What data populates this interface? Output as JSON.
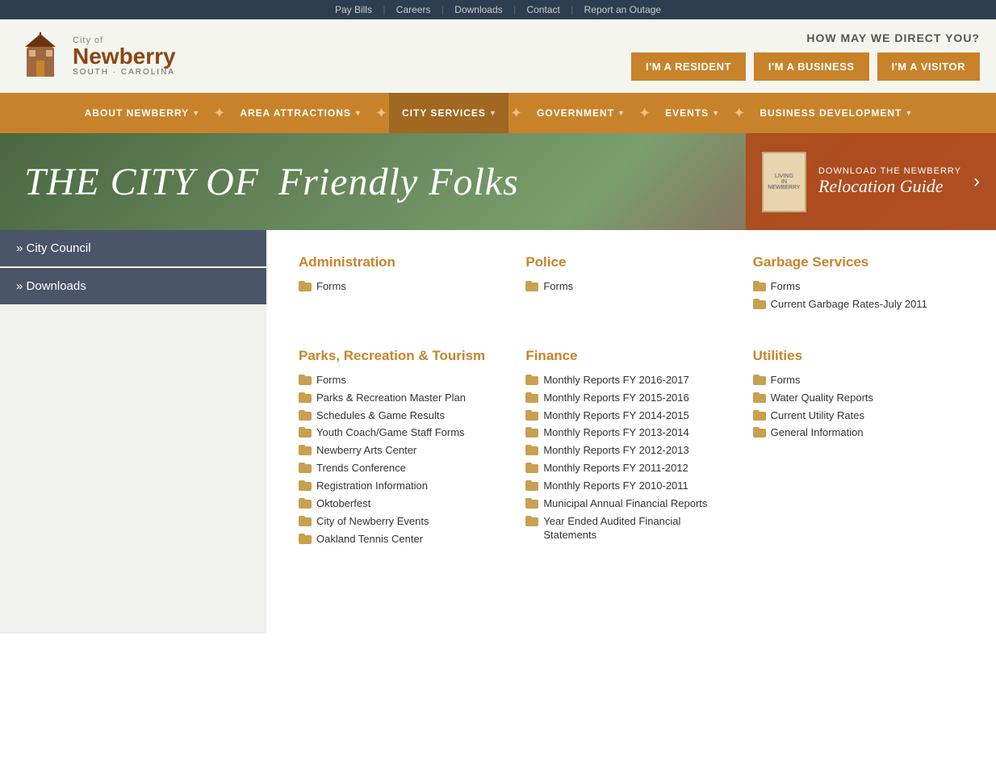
{
  "topbar": {
    "links": [
      "Pay Bills",
      "Careers",
      "Downloads",
      "Contact",
      "Report an Outage"
    ]
  },
  "header": {
    "logo_city": "City of",
    "logo_name": "Newberry",
    "logo_state": "SOUTH · CAROLINA",
    "tagline": "HOW MAY WE DIRECT YOU?",
    "buttons": [
      "I'M A RESIDENT",
      "I'M A BUSINESS",
      "I'M A VISITOR"
    ]
  },
  "nav": {
    "items": [
      "ABOUT NEWBERRY",
      "AREA ATTRACTIONS",
      "CITY SERVICES",
      "GOVERNMENT",
      "EVENTS",
      "BUSINESS DEVELOPMENT"
    ]
  },
  "hero": {
    "text_plain": "THE CITY OF",
    "text_italic": "Friendly Folks",
    "guide_label_small": "DOWNLOAD THE NEWBERRY",
    "guide_label_big": "Relocation Guide"
  },
  "sidebar": {
    "items": [
      {
        "label": "City Council",
        "href": "#"
      },
      {
        "label": "Downloads",
        "href": "#"
      }
    ]
  },
  "page_title": "city SERVICES",
  "sections": {
    "administration": {
      "title": "Administration",
      "items": [
        "Forms"
      ]
    },
    "police": {
      "title": "Police",
      "items": [
        "Forms"
      ]
    },
    "garbage": {
      "title": "Garbage Services",
      "items": [
        "Forms",
        "Current Garbage Rates-July 2011"
      ]
    },
    "parks": {
      "title": "Parks, Recreation & Tourism",
      "items": [
        "Forms",
        "Parks & Recreation Master Plan",
        "Schedules & Game Results",
        "Youth Coach/Game Staff Forms",
        "Newberry Arts Center",
        "Trends Conference",
        "Registration Information",
        "Oktoberfest",
        "City of Newberry Events",
        "Oakland Tennis Center"
      ]
    },
    "finance": {
      "title": "Finance",
      "items": [
        "Monthly Reports FY 2016-2017",
        "Monthly Reports FY 2015-2016",
        "Monthly Reports FY 2014-2015",
        "Monthly Reports FY 2013-2014",
        "Monthly Reports FY 2012-2013",
        "Monthly Reports FY 2011-2012",
        "Monthly Reports FY 2010-2011",
        "Municipal Annual Financial Reports",
        "Year Ended Audited Financial Statements"
      ]
    },
    "utilities": {
      "title": "Utilities",
      "items": [
        "Forms",
        "Water Quality Reports",
        "Current Utility Rates",
        "General Information"
      ]
    }
  }
}
